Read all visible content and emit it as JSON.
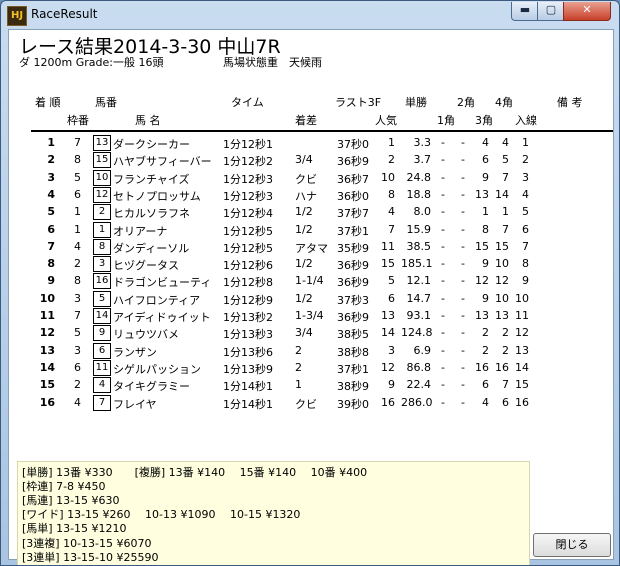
{
  "window": {
    "title": "RaceResult",
    "icon_text": "HJ",
    "min_glyph": "▬",
    "max_glyph": "▢",
    "close_glyph": "✕"
  },
  "race": {
    "title": "レース結果2014-3-30 中山7R",
    "track": "ダ 1200m Grade:一般 16頭",
    "conditions": "馬場状態重　天候雨"
  },
  "headers": {
    "top": [
      "着 順",
      "馬番",
      "タイム",
      "ラスト3F",
      "単勝",
      "2角",
      "4角",
      "備 考"
    ],
    "bottom": [
      "枠番",
      "馬 名",
      "着差",
      "人気",
      "1角",
      "3角",
      "入線"
    ]
  },
  "rows": [
    {
      "pos": "1",
      "waku": "7",
      "ban": "13",
      "name": "ダークシーカー",
      "time": "1分12秒1",
      "margin": "",
      "last3f": "37秒0",
      "ninki": "1",
      "odds": "3.3",
      "c1": "-",
      "c2": "-",
      "c3": "4",
      "c4": "4",
      "finish": "1"
    },
    {
      "pos": "2",
      "waku": "8",
      "ban": "15",
      "name": "ハヤブサフィーバー",
      "time": "1分12秒2",
      "margin": "3/4",
      "last3f": "36秒9",
      "ninki": "2",
      "odds": "3.7",
      "c1": "-",
      "c2": "-",
      "c3": "6",
      "c4": "5",
      "finish": "2"
    },
    {
      "pos": "3",
      "waku": "5",
      "ban": "10",
      "name": "フランチャイズ",
      "time": "1分12秒3",
      "margin": "クビ",
      "last3f": "36秒7",
      "ninki": "10",
      "odds": "24.8",
      "c1": "-",
      "c2": "-",
      "c3": "9",
      "c4": "7",
      "finish": "3"
    },
    {
      "pos": "4",
      "waku": "6",
      "ban": "12",
      "name": "セトノプロッサム",
      "time": "1分12秒3",
      "margin": "ハナ",
      "last3f": "36秒0",
      "ninki": "8",
      "odds": "18.8",
      "c1": "-",
      "c2": "-",
      "c3": "13",
      "c4": "14",
      "finish": "4"
    },
    {
      "pos": "5",
      "waku": "1",
      "ban": "2",
      "name": "ヒカルソラフネ",
      "time": "1分12秒4",
      "margin": "1/2",
      "last3f": "37秒7",
      "ninki": "4",
      "odds": "8.0",
      "c1": "-",
      "c2": "-",
      "c3": "1",
      "c4": "1",
      "finish": "5"
    },
    {
      "pos": "6",
      "waku": "1",
      "ban": "1",
      "name": "オリアーナ",
      "time": "1分12秒5",
      "margin": "1/2",
      "last3f": "37秒1",
      "ninki": "7",
      "odds": "15.9",
      "c1": "-",
      "c2": "-",
      "c3": "8",
      "c4": "7",
      "finish": "6"
    },
    {
      "pos": "7",
      "waku": "4",
      "ban": "8",
      "name": "ダンディーソル",
      "time": "1分12秒5",
      "margin": "アタマ",
      "last3f": "35秒9",
      "ninki": "11",
      "odds": "38.5",
      "c1": "-",
      "c2": "-",
      "c3": "15",
      "c4": "15",
      "finish": "7"
    },
    {
      "pos": "8",
      "waku": "2",
      "ban": "3",
      "name": "ヒヅグータス",
      "time": "1分12秒6",
      "margin": "1/2",
      "last3f": "36秒9",
      "ninki": "15",
      "odds": "185.1",
      "c1": "-",
      "c2": "-",
      "c3": "9",
      "c4": "10",
      "finish": "8"
    },
    {
      "pos": "9",
      "waku": "8",
      "ban": "16",
      "name": "ドラゴンビューティ",
      "time": "1分12秒8",
      "margin": "1-1/4",
      "last3f": "36秒9",
      "ninki": "5",
      "odds": "12.1",
      "c1": "-",
      "c2": "-",
      "c3": "12",
      "c4": "12",
      "finish": "9"
    },
    {
      "pos": "10",
      "waku": "3",
      "ban": "5",
      "name": "ハイフロンティア",
      "time": "1分12秒9",
      "margin": "1/2",
      "last3f": "37秒3",
      "ninki": "6",
      "odds": "14.7",
      "c1": "-",
      "c2": "-",
      "c3": "9",
      "c4": "10",
      "finish": "10"
    },
    {
      "pos": "11",
      "waku": "7",
      "ban": "14",
      "name": "アイディドゥイット",
      "time": "1分13秒2",
      "margin": "1-3/4",
      "last3f": "36秒9",
      "ninki": "13",
      "odds": "93.1",
      "c1": "-",
      "c2": "-",
      "c3": "13",
      "c4": "13",
      "finish": "11"
    },
    {
      "pos": "12",
      "waku": "5",
      "ban": "9",
      "name": "リュウツバメ",
      "time": "1分13秒3",
      "margin": "3/4",
      "last3f": "38秒5",
      "ninki": "14",
      "odds": "124.8",
      "c1": "-",
      "c2": "-",
      "c3": "2",
      "c4": "2",
      "finish": "12"
    },
    {
      "pos": "13",
      "waku": "3",
      "ban": "6",
      "name": "ランザン",
      "time": "1分13秒6",
      "margin": "2",
      "last3f": "38秒8",
      "ninki": "3",
      "odds": "6.9",
      "c1": "-",
      "c2": "-",
      "c3": "2",
      "c4": "2",
      "finish": "13"
    },
    {
      "pos": "14",
      "waku": "6",
      "ban": "11",
      "name": "シゲルパッション",
      "time": "1分13秒9",
      "margin": "2",
      "last3f": "37秒1",
      "ninki": "12",
      "odds": "86.8",
      "c1": "-",
      "c2": "-",
      "c3": "16",
      "c4": "16",
      "finish": "14"
    },
    {
      "pos": "15",
      "waku": "2",
      "ban": "4",
      "name": "タイキグラミー",
      "time": "1分14秒1",
      "margin": "1",
      "last3f": "38秒9",
      "ninki": "9",
      "odds": "22.4",
      "c1": "-",
      "c2": "-",
      "c3": "6",
      "c4": "7",
      "finish": "15"
    },
    {
      "pos": "16",
      "waku": "4",
      "ban": "7",
      "name": "フレイヤ",
      "time": "1分14秒1",
      "margin": "クビ",
      "last3f": "39秒0",
      "ninki": "16",
      "odds": "286.0",
      "c1": "-",
      "c2": "-",
      "c3": "4",
      "c4": "6",
      "finish": "16"
    }
  ],
  "payouts": [
    "[単勝] 13番 ¥330　　[複勝] 13番 ¥140　 15番 ¥140　 10番 ¥400",
    "[枠連] 7-8 ¥450",
    "[馬連] 13-15 ¥630",
    "[ワイド] 13-15 ¥260　 10-13 ¥1090　 10-15 ¥1320",
    "[馬単] 13-15 ¥1210",
    "[3連複] 10-13-15 ¥6070",
    "[3連単] 13-15-10 ¥25590"
  ],
  "buttons": {
    "close_label": "閉じる"
  }
}
